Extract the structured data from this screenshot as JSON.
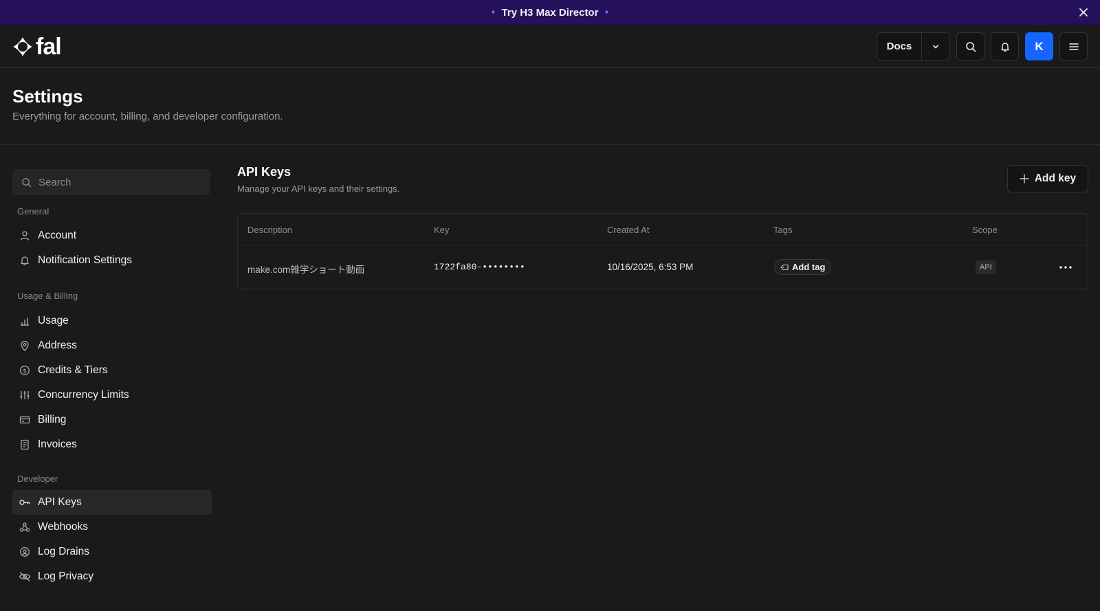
{
  "banner": {
    "text": "Try H3 Max Director",
    "icons": [
      "sparkle-icon",
      "sparkle-icon",
      "close-icon"
    ]
  },
  "topbar": {
    "logo_text": "fal",
    "docs_label": "Docs",
    "avatar_initial": "K",
    "icons": [
      "chevron-down-icon",
      "search-icon",
      "bell-icon",
      "menu-icon"
    ]
  },
  "page": {
    "title": "Settings",
    "subtitle": "Everything for account, billing, and developer configuration."
  },
  "sidebar": {
    "search_placeholder": "Search",
    "sections": [
      {
        "heading": "General",
        "items": [
          {
            "label": "Account",
            "icon": "user-icon"
          },
          {
            "label": "Notification Settings",
            "icon": "bell-icon"
          }
        ]
      },
      {
        "heading": "Usage & Billing",
        "items": [
          {
            "label": "Usage",
            "icon": "bar-chart-icon"
          },
          {
            "label": "Address",
            "icon": "map-pin-icon"
          },
          {
            "label": "Credits & Tiers",
            "icon": "dollar-circle-icon"
          },
          {
            "label": "Concurrency Limits",
            "icon": "sliders-icon"
          },
          {
            "label": "Billing",
            "icon": "credit-card-icon"
          },
          {
            "label": "Invoices",
            "icon": "receipt-icon"
          }
        ]
      },
      {
        "heading": "Developer",
        "items": [
          {
            "label": "API Keys",
            "icon": "key-icon",
            "active": true
          },
          {
            "label": "Webhooks",
            "icon": "webhook-icon"
          },
          {
            "label": "Log Drains",
            "icon": "broadcast-icon"
          },
          {
            "label": "Log Privacy",
            "icon": "eye-off-icon"
          }
        ]
      }
    ]
  },
  "content": {
    "title": "API Keys",
    "subtitle": "Manage your API keys and their settings.",
    "add_key_label": "Add key",
    "table": {
      "columns": [
        "Description",
        "Key",
        "Created At",
        "Tags",
        "Scope"
      ],
      "rows": [
        {
          "description": "make.com雑学ショート動画",
          "key": "1722fa80-••••••••",
          "created_at": "10/16/2025, 6:53 PM",
          "tag_button": "Add tag",
          "scope": "API"
        }
      ]
    }
  },
  "colors": {
    "background": "#1a1a1a",
    "banner": "#25105c",
    "avatar": "#1565ff",
    "active_nav": "#282828"
  }
}
